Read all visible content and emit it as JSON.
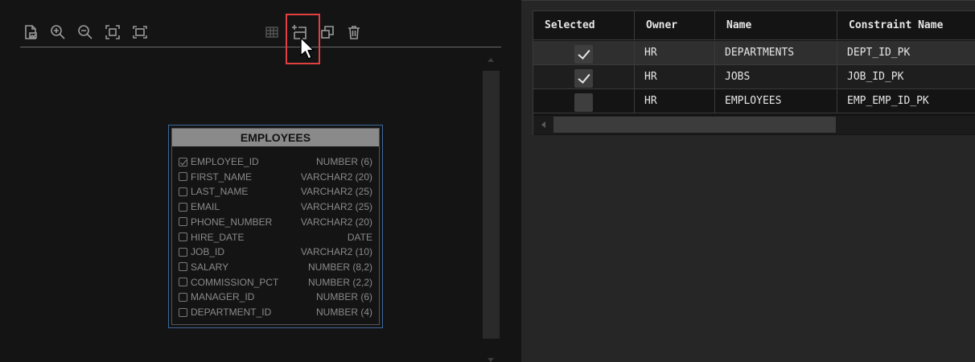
{
  "toolbar": {
    "icons": [
      "export-image-icon",
      "zoom-in-icon",
      "zoom-out-icon",
      "fit-to-window-icon",
      "actual-size-icon",
      "table-icon",
      "add-table-icon",
      "duplicate-icon",
      "delete-icon"
    ],
    "highlighted_icon": "add-table-icon"
  },
  "entity": {
    "title": "EMPLOYEES",
    "columns": [
      {
        "name": "EMPLOYEE_ID",
        "type": "NUMBER (6)",
        "checked": true
      },
      {
        "name": "FIRST_NAME",
        "type": "VARCHAR2 (20)",
        "checked": false
      },
      {
        "name": "LAST_NAME",
        "type": "VARCHAR2 (25)",
        "checked": false
      },
      {
        "name": "EMAIL",
        "type": "VARCHAR2 (25)",
        "checked": false
      },
      {
        "name": "PHONE_NUMBER",
        "type": "VARCHAR2 (20)",
        "checked": false
      },
      {
        "name": "HIRE_DATE",
        "type": "DATE",
        "checked": false
      },
      {
        "name": "JOB_ID",
        "type": "VARCHAR2 (10)",
        "checked": false
      },
      {
        "name": "SALARY",
        "type": "NUMBER (8,2)",
        "checked": false
      },
      {
        "name": "COMMISSION_PCT",
        "type": "NUMBER (2,2)",
        "checked": false
      },
      {
        "name": "MANAGER_ID",
        "type": "NUMBER (6)",
        "checked": false
      },
      {
        "name": "DEPARTMENT_ID",
        "type": "NUMBER (4)",
        "checked": false
      }
    ]
  },
  "grid": {
    "headers": {
      "selected": "Selected",
      "owner": "Owner",
      "name": "Name",
      "constraint": "Constraint Name"
    },
    "rows": [
      {
        "selected": true,
        "owner": "HR",
        "name": "DEPARTMENTS",
        "constraint": "DEPT_ID_PK"
      },
      {
        "selected": true,
        "owner": "HR",
        "name": "JOBS",
        "constraint": "JOB_ID_PK"
      },
      {
        "selected": false,
        "owner": "HR",
        "name": "EMPLOYEES",
        "constraint": "EMP_EMP_ID_PK"
      }
    ]
  },
  "colors": {
    "highlight": "#e04040",
    "entity_border": "#3d6a9b"
  }
}
